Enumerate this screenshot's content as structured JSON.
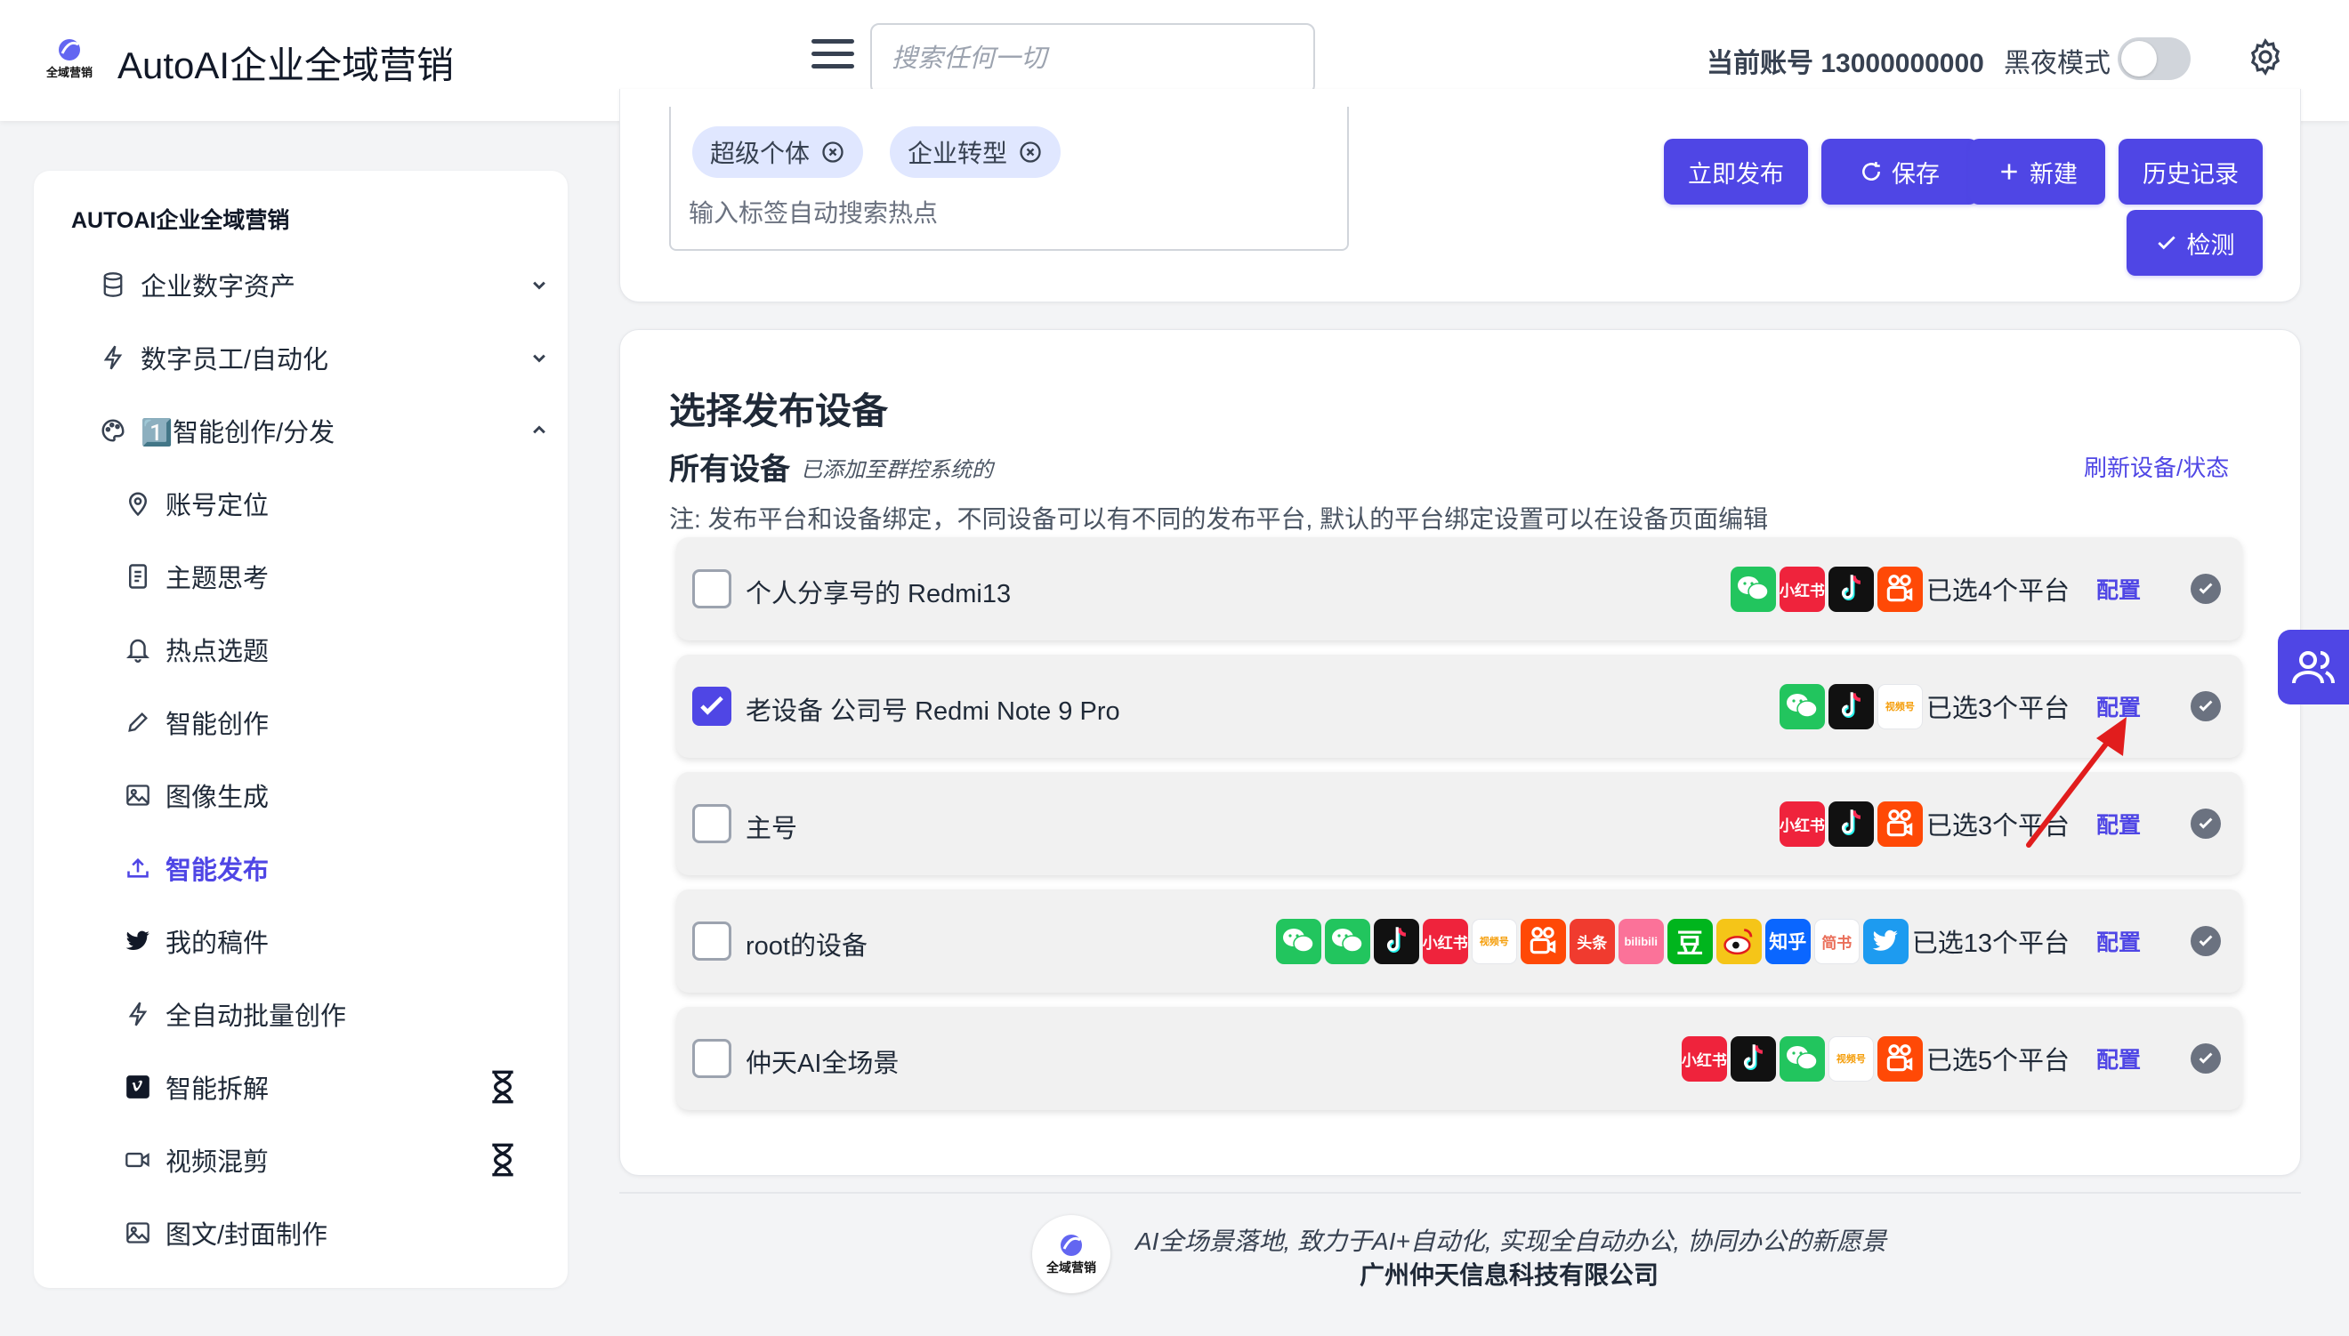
{
  "header": {
    "brand": "AutoAI企业全域营销",
    "logo_text": "全域营销",
    "search_placeholder": "搜索任何一切",
    "account_label": "当前账号 13000000000",
    "dark_mode_label": "黑夜模式",
    "dark_mode_on": false
  },
  "sidebar": {
    "title": "AUTOAI企业全域营销",
    "items": [
      {
        "label": "企业数字资产",
        "icon": "database-icon",
        "expandable": true,
        "expanded": false
      },
      {
        "label": "数字员工/自动化",
        "icon": "bolt-icon",
        "expandable": true,
        "expanded": false
      },
      {
        "label": "1️⃣智能创作/分发",
        "icon": "palette-icon",
        "expandable": true,
        "expanded": true
      },
      {
        "label": "账号定位",
        "icon": "location-pin-icon"
      },
      {
        "label": "主题思考",
        "icon": "document-icon"
      },
      {
        "label": "热点选题",
        "icon": "bell-icon"
      },
      {
        "label": "智能创作",
        "icon": "pencil-icon"
      },
      {
        "label": "图像生成",
        "icon": "image-icon"
      },
      {
        "label": "智能发布",
        "icon": "upload-icon",
        "active": true
      },
      {
        "label": "我的稿件",
        "icon": "twitter-bird-icon"
      },
      {
        "label": "全自动批量创作",
        "icon": "bolt-icon"
      },
      {
        "label": "智能拆解",
        "icon": "vimeo-icon",
        "pending": true
      },
      {
        "label": "视频混剪",
        "icon": "video-camera-icon",
        "pending": true
      },
      {
        "label": "图文/封面制作",
        "icon": "image-icon"
      }
    ]
  },
  "tags": {
    "items": [
      "超级个体",
      "企业转型"
    ],
    "input_placeholder": "输入标签自动搜索热点"
  },
  "actions": {
    "publish": "立即发布",
    "save": "保存",
    "new": "新建",
    "history": "历史记录",
    "check": "检测"
  },
  "devices": {
    "title": "选择发布设备",
    "subtitle": "所有设备",
    "subtitle_hint": "已添加至群控系统的",
    "refresh": "刷新设备/状态",
    "note": "注: 发布平台和设备绑定，不同设备可以有不同的发布平台, 默认的平台绑定设置可以在设备页面编辑",
    "config_label": "配置",
    "list": [
      {
        "name": "个人分享号的 Redmi13",
        "checked": false,
        "count_text": "已选4个平台",
        "platforms": [
          "wechat",
          "xiaohongshu",
          "douyin",
          "kuaishou"
        ]
      },
      {
        "name": "老设备 公司号 Redmi Note 9 Pro",
        "checked": true,
        "count_text": "已选3个平台",
        "platforms": [
          "wechat-channels",
          "douyin",
          "shipinhao"
        ]
      },
      {
        "name": "主号",
        "checked": false,
        "count_text": "已选3个平台",
        "platforms": [
          "xiaohongshu",
          "douyin",
          "kuaishou"
        ]
      },
      {
        "name": "root的设备",
        "checked": false,
        "count_text": "已选13个平台",
        "platforms": [
          "wechat",
          "wechat-channels",
          "douyin",
          "xiaohongshu",
          "shipinhao",
          "kuaishou",
          "toutiao",
          "bilibili",
          "douban",
          "weibo",
          "zhihu",
          "jianshu",
          "twitter"
        ]
      },
      {
        "name": "仲天AI全场景",
        "checked": false,
        "count_text": "已选5个平台",
        "platforms": [
          "xiaohongshu",
          "douyin",
          "wechat-channels",
          "shipinhao",
          "kuaishou"
        ]
      }
    ]
  },
  "platform_text": {
    "xiaohongshu": "小红书",
    "toutiao": "头条",
    "bilibili": "bilibili",
    "douban": "豆",
    "zhihu": "知乎",
    "jianshu": "简书",
    "shipinhao": "视频号"
  },
  "colors": {
    "accent": "#4f46e5",
    "wechat": "#22c55e",
    "xiaohongshu": "#ef233c",
    "douyin": "#111111",
    "kuaishou": "#ff4906",
    "toutiao": "#f03b2f",
    "bilibili": "#fb7299",
    "douban": "#00b51d",
    "weibo": "#f5c518",
    "zhihu": "#0a66ff",
    "twitter": "#1d9bf0"
  },
  "footer": {
    "slogan": "AI全场景落地, 致力于AI+自动化, 实现全自动办公, 协同办公的新愿景",
    "company": "广州仲天信息科技有限公司"
  }
}
